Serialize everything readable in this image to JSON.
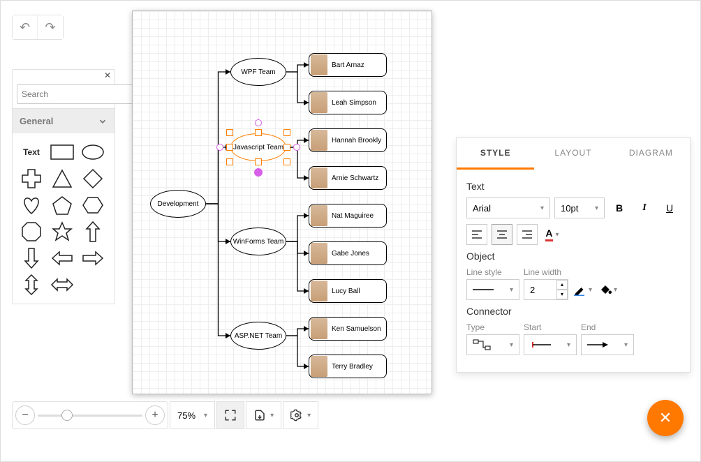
{
  "toolbar": {
    "undo_title": "Undo",
    "redo_title": "Redo"
  },
  "palette": {
    "search_placeholder": "Search",
    "section_title": "General",
    "text_shape_label": "Text"
  },
  "zoom": {
    "value": "75%"
  },
  "props": {
    "tabs": {
      "style": "STYLE",
      "layout": "LAYOUT",
      "diagram": "DIAGRAM"
    },
    "text_header": "Text",
    "font_family": "Arial",
    "font_size": "10pt",
    "object_header": "Object",
    "line_style_label": "Line style",
    "line_width_label": "Line width",
    "line_width_value": "2",
    "connector_header": "Connector",
    "connector_type_label": "Type",
    "connector_start_label": "Start",
    "connector_end_label": "End"
  },
  "diagram": {
    "root": "Development",
    "teams": [
      {
        "name": "WPF Team",
        "selected": false,
        "members": [
          "Bart Arnaz",
          "Leah Simpson"
        ]
      },
      {
        "name": "Javascript Team",
        "selected": true,
        "members": [
          "Hannah Brookly",
          "Arnie Schwartz"
        ]
      },
      {
        "name": "WinForms Team",
        "selected": false,
        "members": [
          "Nat Maguiree",
          "Gabe Jones",
          "Lucy Ball"
        ]
      },
      {
        "name": "ASP.NET Team",
        "selected": false,
        "members": [
          "Ken Samuelson",
          "Terry Bradley"
        ]
      }
    ]
  }
}
